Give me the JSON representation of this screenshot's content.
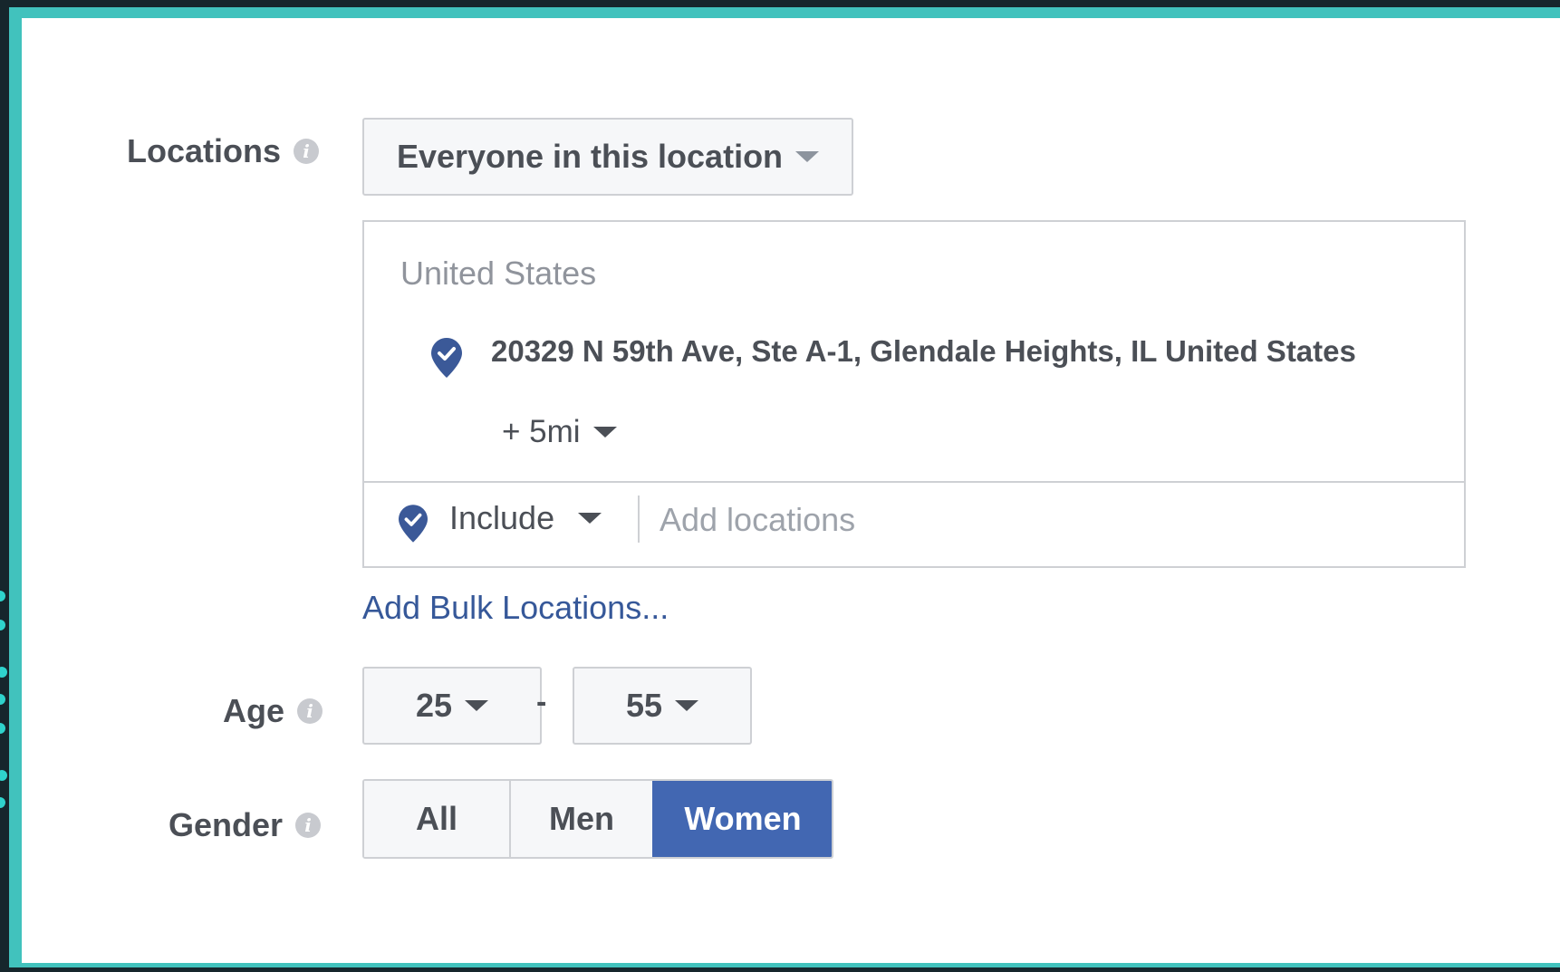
{
  "colors": {
    "accent": "#4267b2",
    "link": "#365899",
    "frame": "#41c2bd"
  },
  "locations": {
    "label": "Locations",
    "info_icon": "i",
    "mode_select": "Everyone in this location",
    "country": "United States",
    "address": "20329 N 59th Ave, Ste A-1, Glendale Heights, IL United States",
    "radius": "+ 5mi",
    "include_select": "Include",
    "add_placeholder": "Add locations",
    "bulk_link": "Add Bulk Locations..."
  },
  "age": {
    "label": "Age",
    "info_icon": "i",
    "min": "25",
    "separator": "-",
    "max": "55"
  },
  "gender": {
    "label": "Gender",
    "info_icon": "i",
    "options": [
      "All",
      "Men",
      "Women"
    ],
    "selected": "Women"
  }
}
